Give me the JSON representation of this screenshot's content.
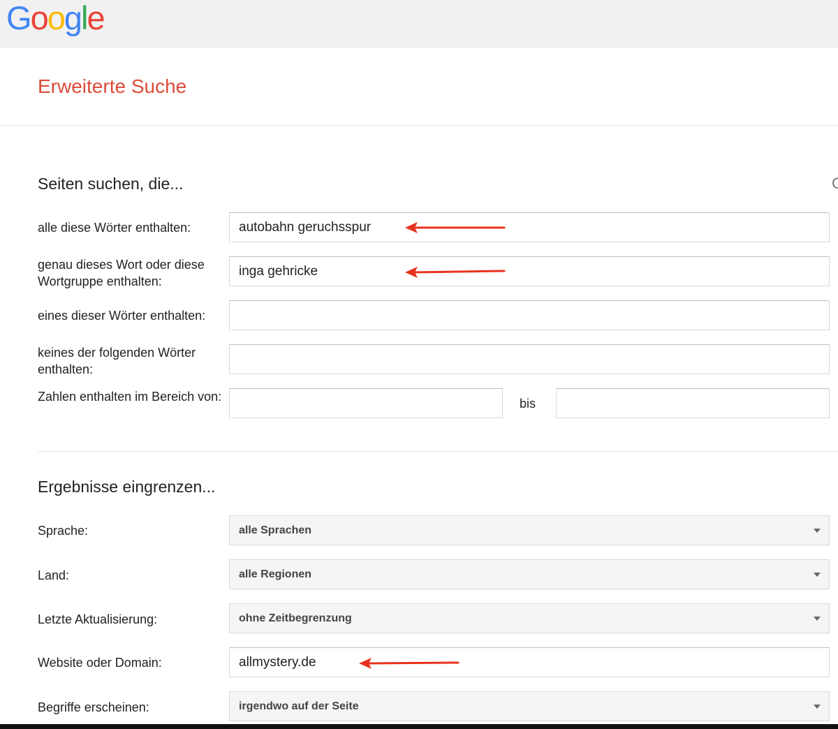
{
  "header": {
    "logo_letters": [
      {
        "char": "G",
        "color": "#4285f4"
      },
      {
        "char": "o",
        "color": "#ea4335"
      },
      {
        "char": "o",
        "color": "#fbbc05"
      },
      {
        "char": "g",
        "color": "#4285f4"
      },
      {
        "char": "l",
        "color": "#34a853"
      },
      {
        "char": "e",
        "color": "#ea4335"
      }
    ]
  },
  "page": {
    "title": "Erweiterte Suche",
    "title_color": "#dd4b39",
    "edge_glyph": "C"
  },
  "find_pages": {
    "heading": "Seiten suchen, die...",
    "all_words": {
      "label": "alle diese Wörter enthalten:",
      "value": "autobahn geruchsspur"
    },
    "exact_phrase": {
      "label": "genau dieses Wort oder diese Wortgruppe enthalten:",
      "value": "inga gehricke"
    },
    "any_words": {
      "label": "eines dieser Wörter enthalten:",
      "value": ""
    },
    "none_words": {
      "label": "keines der folgenden Wörter enthalten:",
      "value": ""
    },
    "number_range": {
      "label": "Zahlen enthalten im Bereich von:",
      "from_value": "",
      "separator": "bis",
      "to_value": ""
    }
  },
  "narrow_results": {
    "heading": "Ergebnisse eingrenzen...",
    "language": {
      "label": "Sprache:",
      "selected": "alle Sprachen"
    },
    "region": {
      "label": "Land:",
      "selected": "alle Regionen"
    },
    "last_update": {
      "label": "Letzte Aktualisierung:",
      "selected": "ohne Zeitbegrenzung"
    },
    "site_domain": {
      "label": "Website oder Domain:",
      "value": "allmystery.de"
    },
    "terms_appearing": {
      "label": "Begriffe erscheinen:",
      "selected": "irgendwo auf der Seite"
    }
  },
  "annotation": {
    "arrow_color": "#e8321e"
  }
}
